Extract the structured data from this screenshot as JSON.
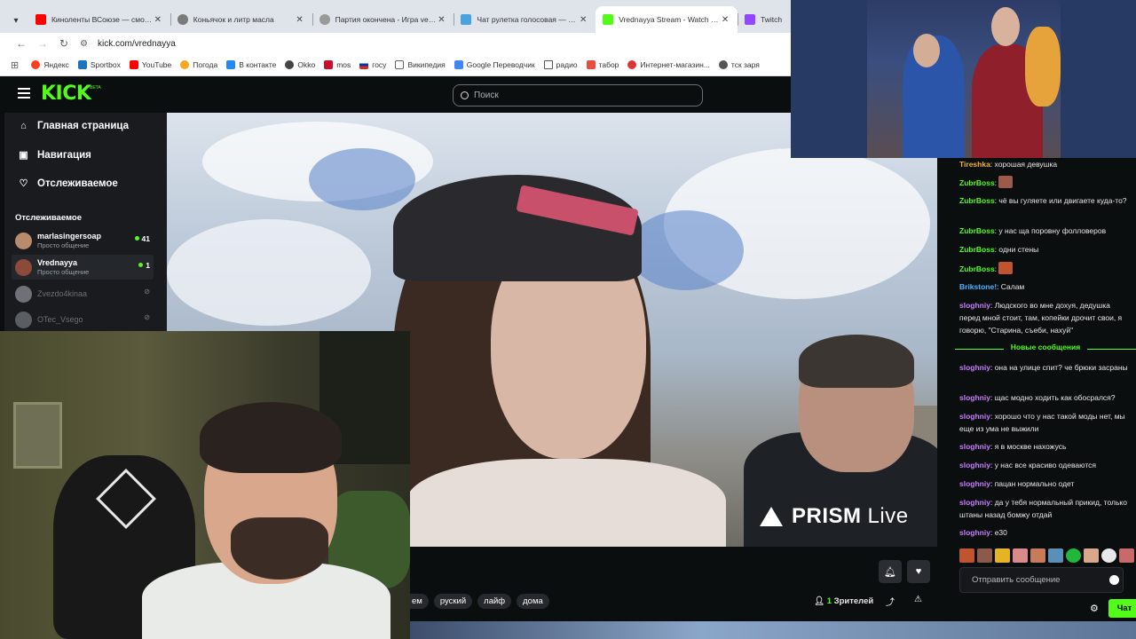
{
  "browser": {
    "tabs": [
      {
        "title": "Киноленты ВСоюзе — смотре",
        "color": "#ff0000"
      },
      {
        "title": "Коньячок и литр масла",
        "color": "#7a7a7a"
      },
      {
        "title": "Партия окончена - Игра vege",
        "color": "#9a9a9a"
      },
      {
        "title": "Чат рулетка голосовая — Nek",
        "color": "#4aa3df"
      },
      {
        "title": "Vrednayya Stream - Watch Live",
        "color": "#53fc18"
      },
      {
        "title": "Twitch",
        "color": "#9146ff"
      }
    ],
    "url": "kick.com/vrednayya",
    "bookmarks": [
      "Яндекс",
      "Sportbox",
      "YouTube",
      "Погода",
      "В контакте",
      "Okko",
      "mos",
      "госу",
      "Википедия",
      "Google Переводчик",
      "радио",
      "табор",
      "Интернет-магазин...",
      "тск заря"
    ]
  },
  "kick": {
    "logo": "KICK",
    "beta": "BETA",
    "search_placeholder": "Поиск",
    "nav": [
      "Главная страница",
      "Навигация",
      "Отслеживаемое"
    ],
    "following_header": "Отслеживаемое",
    "channels": [
      {
        "name": "marlasingersoap",
        "sub": "Просто общение",
        "count": "41",
        "live": true,
        "color": "#b88b6d"
      },
      {
        "name": "Vrednayya",
        "sub": "Просто общение",
        "count": "1",
        "live": true,
        "color": "#8b4a3a"
      },
      {
        "name": "Zvezdo4kinaa",
        "sub": "",
        "count": "",
        "live": false,
        "color": "#6e7278"
      },
      {
        "name": "OTec_Vsego",
        "sub": "",
        "count": "",
        "live": false,
        "color": "#5a5e63"
      }
    ],
    "watermark": {
      "brand": "PRISM",
      "suffix": "Live"
    },
    "tags": [
      "ем",
      "руский",
      "лайф",
      "дома"
    ],
    "viewers": {
      "count": "1",
      "label": "Зрителей"
    }
  },
  "chat": {
    "messages": [
      {
        "user": "Tireshka",
        "color": "#f0b429",
        "text": "хорошая девушка"
      },
      {
        "user": "ZubrBoss",
        "color": "#53fc18",
        "text": "",
        "emote": "#9b5a4a"
      },
      {
        "user": "ZubrBoss",
        "color": "#53fc18",
        "text": "чё вы гуляете или двигаете куда-то?"
      },
      {
        "user": "ZubrBoss",
        "color": "#53fc18",
        "text": "у нас ща поровну фолловеров"
      },
      {
        "user": "ZubrBoss",
        "color": "#53fc18",
        "text": "одни стены"
      },
      {
        "user": "ZubrBoss",
        "color": "#53fc18",
        "text": "",
        "emote": "#c0542e"
      },
      {
        "user": "Brikstone!",
        "color": "#4ab3ff",
        "text": "Салам"
      },
      {
        "user": "sloghniy",
        "color": "#c77dff",
        "text": "Людского во мне дохуя, дедушка перед мной стоит, там, копейки дрочит свои, я говорю, \"Старина, съеби, нахуй\""
      },
      {
        "user": "sloghniy",
        "color": "#c77dff",
        "text": "она на улице спит? че брюки засраны"
      },
      {
        "user": "sloghniy",
        "color": "#c77dff",
        "text": "щас модно ходить как обосрался?"
      },
      {
        "user": "sloghniy",
        "color": "#c77dff",
        "text": "хорошо что у нас такой моды нет, мы еще из ума не выжили"
      },
      {
        "user": "sloghniy",
        "color": "#c77dff",
        "text": "я в москве нахожусь"
      },
      {
        "user": "sloghniy",
        "color": "#c77dff",
        "text": "у нас все красиво одеваются"
      },
      {
        "user": "sloghniy",
        "color": "#c77dff",
        "text": "пацан нормально одет"
      },
      {
        "user": "sloghniy",
        "color": "#c77dff",
        "text": "да у тебя нормальный прикид, только штаны назад бомжу отдай"
      },
      {
        "user": "sloghniy",
        "color": "#c77dff",
        "text": "е30"
      }
    ],
    "new_messages_label": "Новые сообщения",
    "input_placeholder": "Отправить сообщение",
    "send_label": "Чат"
  }
}
